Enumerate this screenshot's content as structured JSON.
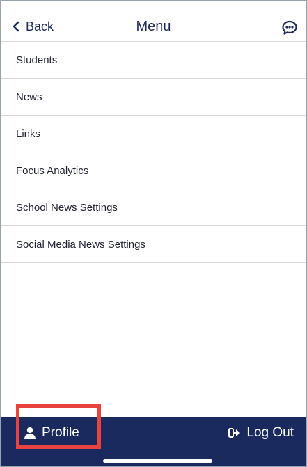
{
  "header": {
    "back_label": "Back",
    "title": "Menu",
    "chat_icon": "chat-bubble-icon"
  },
  "menu": {
    "items": [
      {
        "label": "Students"
      },
      {
        "label": "News"
      },
      {
        "label": "Links"
      },
      {
        "label": "Focus Analytics"
      },
      {
        "label": "School News Settings"
      },
      {
        "label": "Social Media News Settings"
      }
    ]
  },
  "footer": {
    "profile_label": "Profile",
    "profile_icon": "user-icon",
    "logout_label": "Log Out",
    "logout_icon": "sign-out-icon"
  },
  "colors": {
    "primary": "#1d2a57",
    "footer_bg": "#1b2a5e",
    "highlight": "#e8443d",
    "divider": "#d6d6d6"
  }
}
